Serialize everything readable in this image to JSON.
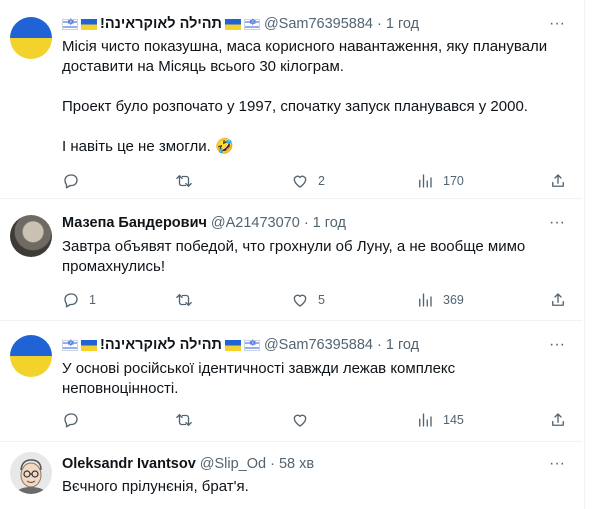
{
  "tweets": [
    {
      "display_name": "תהילה לאוקראינה!",
      "handle": "@Sam76395884",
      "separator": "·",
      "time": "1 год",
      "paragraphs": [
        "Місія чисто показушна, маса корисного навантаження, яку планували доставити на Місяць всього 30 кілограм.",
        "Проект було розпочато у 1997, спочатку запуск планувався у 2000.",
        "І навіть це не змогли. 🤣"
      ],
      "replies": "",
      "retweets": "",
      "likes": "2",
      "views": "170"
    },
    {
      "display_name": "Мазепа Бандерович",
      "handle": "@A21473070",
      "separator": "·",
      "time": "1 год",
      "paragraphs": [
        "Завтра объявят победой, что грохнули об Луну, а не вообще мимо промахнулись!"
      ],
      "replies": "1",
      "retweets": "",
      "likes": "5",
      "views": "369"
    },
    {
      "display_name": "תהילה לאוקראינה!",
      "handle": "@Sam76395884",
      "separator": "·",
      "time": "1 год",
      "paragraphs": [
        "У основі російської ідентичності завжди лежав комплекс неповноцінності."
      ],
      "replies": "",
      "retweets": "",
      "likes": "",
      "views": "145"
    },
    {
      "display_name": "Oleksandr Ivantsov",
      "handle": "@Slip_Od",
      "separator": "·",
      "time": "58 хв",
      "paragraphs": [
        "Вєчного прілунєнія, брат'я."
      ]
    }
  ],
  "more_label": "···",
  "colors": {
    "text": "#0f1419",
    "secondary": "#536471",
    "border": "#eff3f4",
    "flag_blue": "#1f63d6",
    "flag_yellow": "#f2d22b"
  }
}
